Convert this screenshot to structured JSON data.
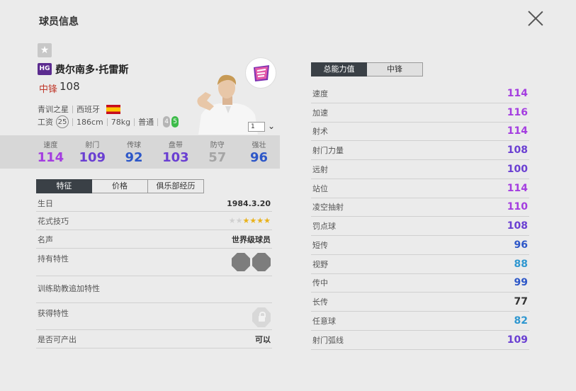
{
  "title": "球员信息",
  "player": {
    "badge": "HG",
    "name": "费尔南多·托雷斯",
    "position": "中锋",
    "overall": "108",
    "category": "青训之星",
    "nation": "西班牙",
    "salary_label": "工资",
    "salary": "25",
    "height": "186cm",
    "weight": "78kg",
    "body_type": "普通",
    "weak_foot": "4",
    "strong_foot": "5",
    "jersey": "1"
  },
  "colors": {
    "purple": "#a43de0",
    "violet": "#6a3fd2",
    "blue": "#2d57c8",
    "teal": "#2f97d0",
    "dark": "#333333",
    "gray": "#a5a5a5",
    "position_red": "#c0392b",
    "tab_active": "#3a4046",
    "gold": "#e9b21a"
  },
  "summary_stats": [
    {
      "label": "速度",
      "value": "114",
      "color": "#a43de0"
    },
    {
      "label": "射门",
      "value": "109",
      "color": "#6a3fd2"
    },
    {
      "label": "传球",
      "value": "92",
      "color": "#2d57c8"
    },
    {
      "label": "盘带",
      "value": "103",
      "color": "#6a3fd2"
    },
    {
      "label": "防守",
      "value": "57",
      "color": "#a5a5a5"
    },
    {
      "label": "强壮",
      "value": "96",
      "color": "#2d57c8"
    }
  ],
  "left_tabs": [
    "特征",
    "价格",
    "俱乐部经历"
  ],
  "details": {
    "birthday_label": "生日",
    "birthday": "1984.3.20",
    "skill_label": "花式技巧",
    "skill_stars": 4,
    "skill_stars_max": 6,
    "fame_label": "名声",
    "fame": "世界级球员",
    "traits_label": "持有特性",
    "coach_traits_label": "训练助教追加特性",
    "acquired_traits_label": "获得特性",
    "producible_label": "是否可产出",
    "producible": "可以"
  },
  "right_tabs": [
    "总能力值",
    "中锋"
  ],
  "attributes": [
    {
      "name": "速度",
      "value": "114",
      "color": "#a43de0"
    },
    {
      "name": "加速",
      "value": "116",
      "color": "#a43de0"
    },
    {
      "name": "射术",
      "value": "114",
      "color": "#a43de0"
    },
    {
      "name": "射门力量",
      "value": "108",
      "color": "#6a3fd2"
    },
    {
      "name": "远射",
      "value": "100",
      "color": "#6a3fd2"
    },
    {
      "name": "站位",
      "value": "114",
      "color": "#a43de0"
    },
    {
      "name": "凌空抽射",
      "value": "110",
      "color": "#a43de0"
    },
    {
      "name": "罚点球",
      "value": "108",
      "color": "#6a3fd2"
    },
    {
      "name": "短传",
      "value": "96",
      "color": "#2d57c8"
    },
    {
      "name": "视野",
      "value": "88",
      "color": "#2f97d0"
    },
    {
      "name": "传中",
      "value": "99",
      "color": "#2d57c8"
    },
    {
      "name": "长传",
      "value": "77",
      "color": "#333333"
    },
    {
      "name": "任意球",
      "value": "82",
      "color": "#2f97d0"
    },
    {
      "name": "射门弧线",
      "value": "109",
      "color": "#6a3fd2"
    }
  ]
}
